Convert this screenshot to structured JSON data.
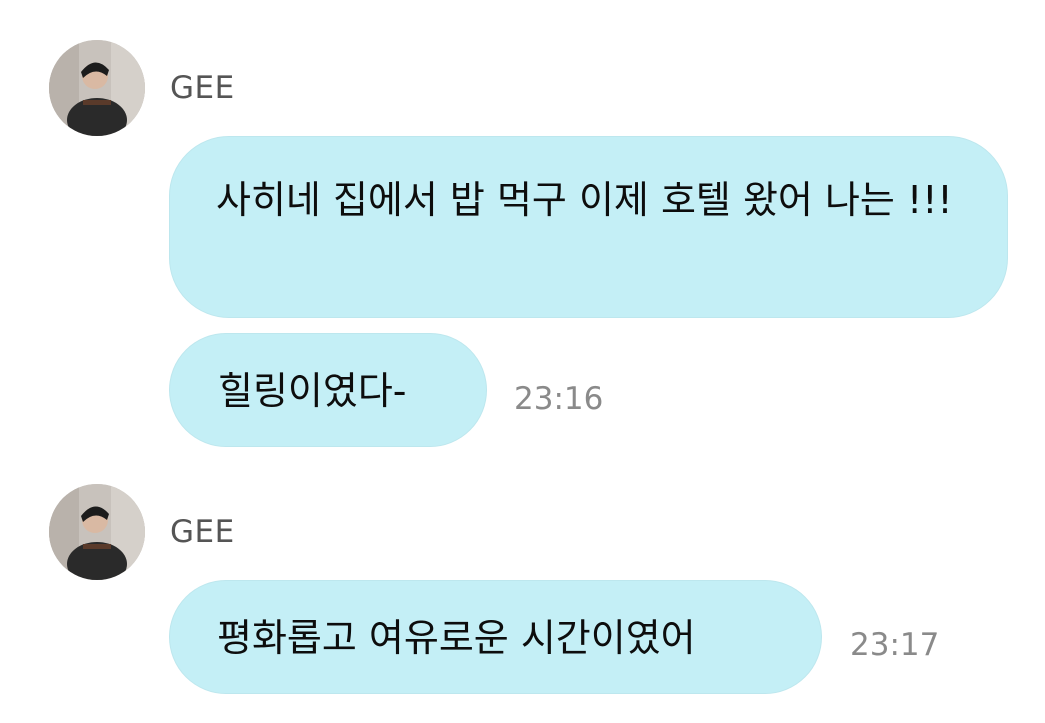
{
  "messages": [
    {
      "sender": "GEE",
      "bubbles": [
        "사히네 집에서 밥 먹구 이제 호텔 왔어 나는 !!!",
        "힐링이였다-"
      ],
      "time": "23:16"
    },
    {
      "sender": "GEE",
      "bubbles": [
        "평화롭고 여유로운 시간이였어"
      ],
      "time": "23:17"
    }
  ],
  "colors": {
    "bubble_bg": "#c4eff6",
    "sender_text": "#555555",
    "time_text": "#8a8a8a"
  },
  "icons": {
    "avatar": "profile-photo"
  }
}
